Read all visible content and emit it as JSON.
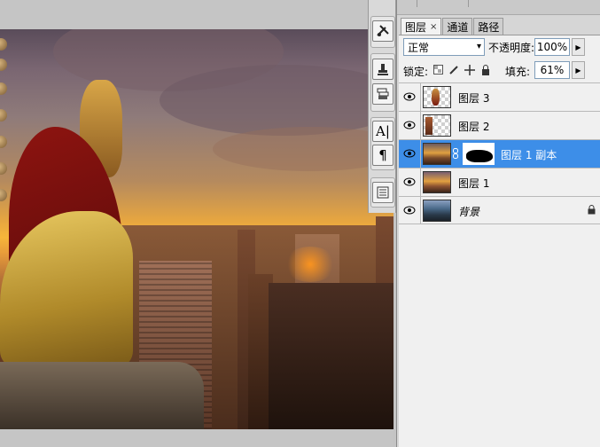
{
  "tabs": [
    {
      "label": "图层",
      "close": "×"
    },
    {
      "label": "通道"
    },
    {
      "label": "路径"
    }
  ],
  "blend_mode": {
    "value": "正常",
    "arrow": "▾"
  },
  "opacity": {
    "label": "不透明度:",
    "value": "100%"
  },
  "lock": {
    "label": "锁定:"
  },
  "fill": {
    "label": "填充:",
    "value": "61%"
  },
  "layers": [
    {
      "name": "图层 3",
      "visible": true,
      "selected": false
    },
    {
      "name": "图层 2",
      "visible": true,
      "selected": false
    },
    {
      "name": "图层 1 副本",
      "visible": true,
      "selected": true,
      "has_mask": true
    },
    {
      "name": "图层 1",
      "visible": true,
      "selected": false
    },
    {
      "name": "背景",
      "visible": true,
      "selected": false,
      "locked": true
    }
  ],
  "icons": {
    "eye": "eye-icon",
    "lock": "lock-icon",
    "chain": "chain-icon",
    "stepper": "stepper-arrow-icon",
    "tools": [
      "tools-icon",
      "stamp-icon",
      "layer-comps-icon",
      "character-icon",
      "paragraph-icon",
      "notes-icon"
    ]
  },
  "colors": {
    "selection": "#3d8ee8",
    "panel_bg": "#f0f0f0"
  }
}
